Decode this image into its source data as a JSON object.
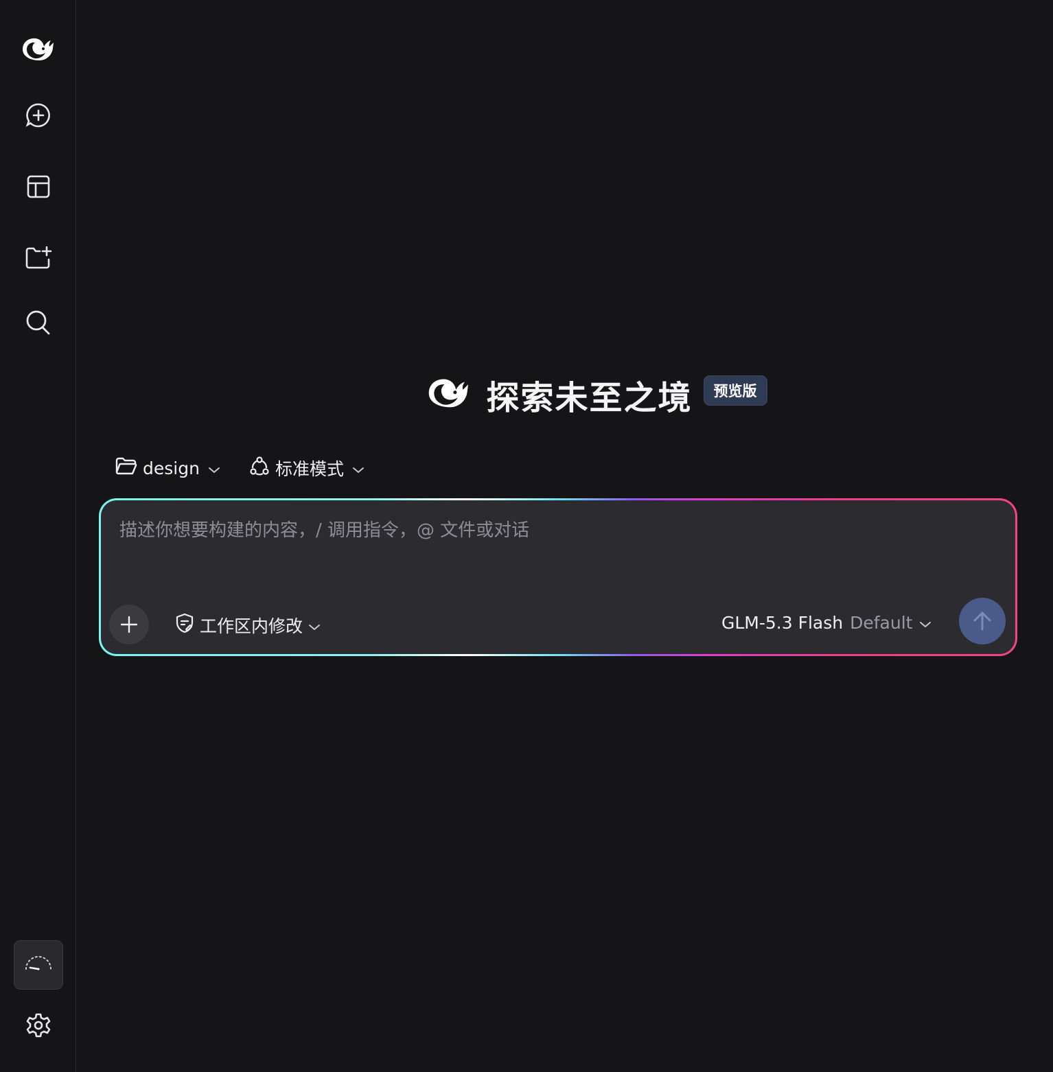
{
  "sidebar": {
    "items": [
      {
        "icon": "whale-logo-icon"
      },
      {
        "icon": "new-chat-icon"
      },
      {
        "icon": "layout-icon"
      },
      {
        "icon": "new-folder-icon"
      },
      {
        "icon": "search-icon"
      }
    ],
    "bottom": [
      {
        "icon": "gauge-icon"
      },
      {
        "icon": "gear-icon"
      }
    ]
  },
  "hero": {
    "title": "探索未至之境",
    "badge": "预览版"
  },
  "selectors": {
    "workspace": "design",
    "mode": "标准模式"
  },
  "composer": {
    "placeholder": "描述你想要构建的内容，/ 调用指令，@ 文件或对话",
    "permission": "工作区内修改",
    "model_name": "GLM-5.3 Flash",
    "model_tag": "Default"
  },
  "colors": {
    "background": "#151517",
    "composer_bg": "#2c2c30",
    "send_button": "#4a5a8a",
    "badge_bg": "#2f3a55",
    "gradient_start": "#7af5ef",
    "gradient_end": "#f5428c"
  }
}
